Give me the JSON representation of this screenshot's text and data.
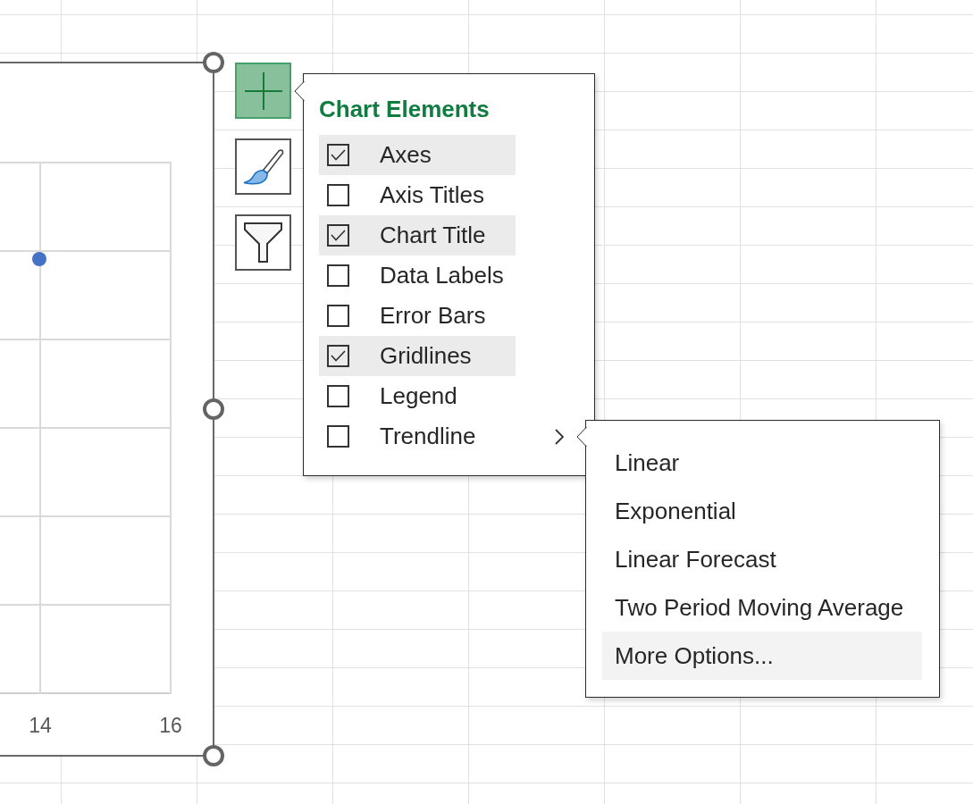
{
  "chart": {
    "x_tick_labels": [
      "14",
      "16"
    ]
  },
  "chart_buttons": [
    {
      "kind": "add",
      "selected": true
    },
    {
      "kind": "style",
      "selected": false
    },
    {
      "kind": "filter",
      "selected": false
    }
  ],
  "chart_elements": {
    "title": "Chart Elements",
    "items": [
      {
        "label": "Axes",
        "checked": true,
        "has_submenu": false
      },
      {
        "label": "Axis Titles",
        "checked": false,
        "has_submenu": false
      },
      {
        "label": "Chart Title",
        "checked": true,
        "has_submenu": false
      },
      {
        "label": "Data Labels",
        "checked": false,
        "has_submenu": false
      },
      {
        "label": "Error Bars",
        "checked": false,
        "has_submenu": false
      },
      {
        "label": "Gridlines",
        "checked": true,
        "has_submenu": false
      },
      {
        "label": "Legend",
        "checked": false,
        "has_submenu": false
      },
      {
        "label": "Trendline",
        "checked": false,
        "has_submenu": true
      }
    ]
  },
  "trendline_submenu": {
    "items": [
      {
        "label": "Linear",
        "selected": false
      },
      {
        "label": "Exponential",
        "selected": false
      },
      {
        "label": "Linear Forecast",
        "selected": false
      },
      {
        "label": "Two Period Moving Average",
        "selected": false
      },
      {
        "label": "More Options...",
        "selected": true
      }
    ]
  }
}
